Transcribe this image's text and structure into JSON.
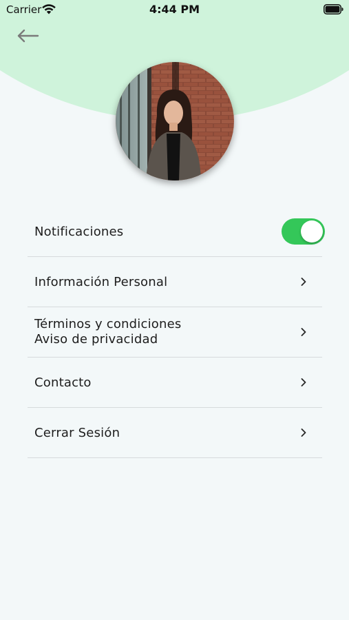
{
  "status_bar": {
    "carrier": "Carrier",
    "time": "4:44 PM",
    "wifi_icon": "wifi-icon",
    "battery_icon": "battery-full-icon"
  },
  "header": {
    "back_icon": "arrow-left-icon",
    "accent_color": "#cff3db"
  },
  "profile": {
    "avatar": "profile-photo"
  },
  "menu": {
    "notifications": {
      "label": "Notificaciones",
      "toggle_on": true,
      "toggle_color": "#34c759"
    },
    "items": [
      {
        "label": "Información Personal",
        "icon": "chevron-right-icon"
      },
      {
        "label_line1": "Términos y condiciones",
        "label_line2": "Aviso de privacidad",
        "icon": "chevron-right-icon"
      },
      {
        "label": "Contacto",
        "icon": "chevron-right-icon"
      },
      {
        "label": "Cerrar Sesión",
        "icon": "chevron-right-icon"
      }
    ]
  }
}
